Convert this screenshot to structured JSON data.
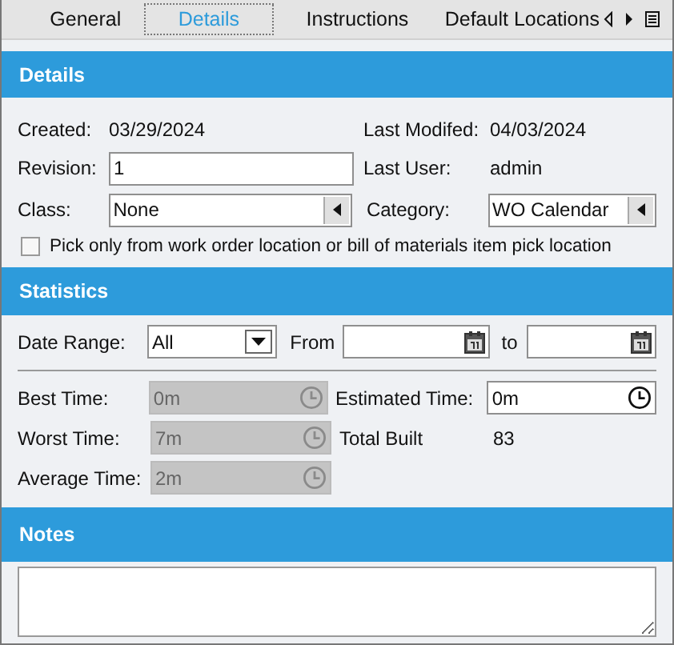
{
  "tabs": [
    {
      "label": "General",
      "selected": false
    },
    {
      "label": "Details",
      "selected": true
    },
    {
      "label": "Instructions",
      "selected": false
    },
    {
      "label": "Default Locations",
      "selected": false
    }
  ],
  "details": {
    "title": "Details",
    "created": {
      "label": "Created:",
      "value": "03/29/2024"
    },
    "last_modified": {
      "label": "Last Modifed:",
      "value": "04/03/2024"
    },
    "revision": {
      "label": "Revision:",
      "value": "1"
    },
    "last_user": {
      "label": "Last User:",
      "value": "admin"
    },
    "class": {
      "label": "Class:",
      "value": "None"
    },
    "category": {
      "label": "Category:",
      "value": "WO Calendar"
    },
    "pick_only": {
      "label": "Pick only from work order location or bill of materials item pick location",
      "checked": false
    }
  },
  "statistics": {
    "title": "Statistics",
    "date_range": {
      "label": "Date Range:",
      "value": "All"
    },
    "from": {
      "label": "From"
    },
    "to": {
      "label": "to"
    },
    "best_time": {
      "label": "Best Time:",
      "value": "0m",
      "disabled": true
    },
    "estimated_time": {
      "label": "Estimated Time:",
      "value": "0m",
      "disabled": false
    },
    "worst_time": {
      "label": "Worst Time:",
      "value": "7m",
      "disabled": true
    },
    "total_built": {
      "label": "Total Built",
      "value": "83"
    },
    "average_time": {
      "label": "Average Time:",
      "value": "2m",
      "disabled": true
    }
  },
  "notes": {
    "title": "Notes"
  }
}
